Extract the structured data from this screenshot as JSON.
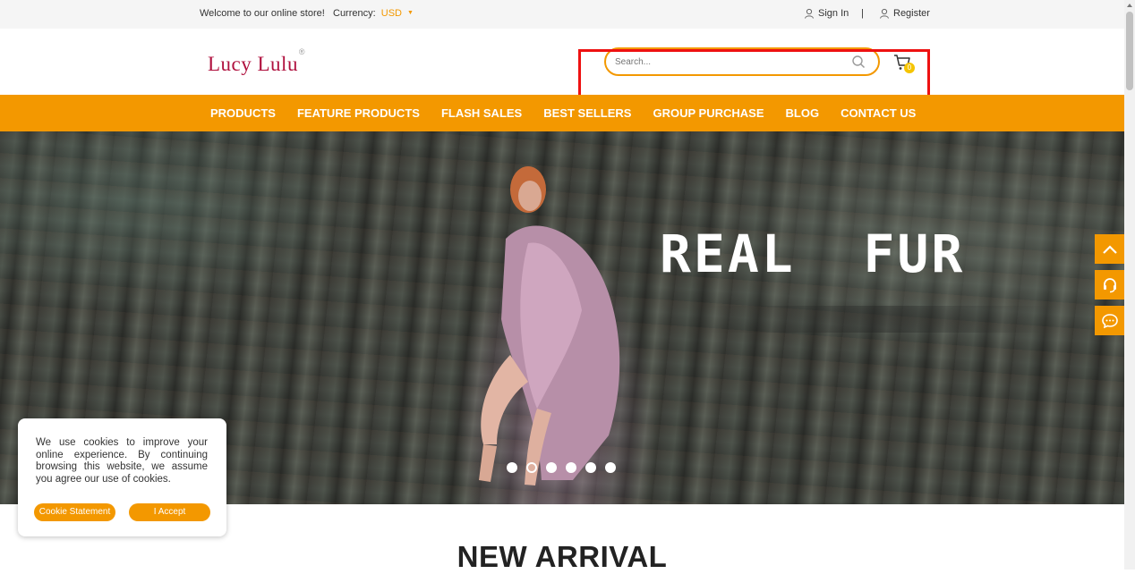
{
  "topbar": {
    "welcome": "Welcome to our online store!",
    "currency_label": "Currency:",
    "currency_value": "USD",
    "sign_in": "Sign In",
    "separator": "|",
    "register": "Register"
  },
  "header": {
    "logo_text": "Lucy Lulu",
    "logo_reg": "®",
    "search_placeholder": "Search...",
    "cart_count": "0"
  },
  "nav": {
    "items": [
      "PRODUCTS",
      "FEATURE PRODUCTS",
      "FLASH SALES",
      "BEST SELLERS",
      "GROUP PURCHASE",
      "BLOG",
      "CONTACT US"
    ]
  },
  "banner": {
    "headline": "REAL  FUR",
    "slide_count": 6,
    "active_slide": 2
  },
  "side_buttons": [
    "chevron-up-icon",
    "headset-icon",
    "chat-icon"
  ],
  "cookie": {
    "message": "We use cookies to improve your online experience. By continuing browsing this website, we assume you agree our use of cookies.",
    "statement_button": "Cookie Statement",
    "accept_button": "I Accept"
  },
  "section": {
    "title": "NEW ARRIVAL"
  },
  "colors": {
    "accent": "#f39800",
    "logo": "#b0123f",
    "highlight": "#ee1111"
  }
}
